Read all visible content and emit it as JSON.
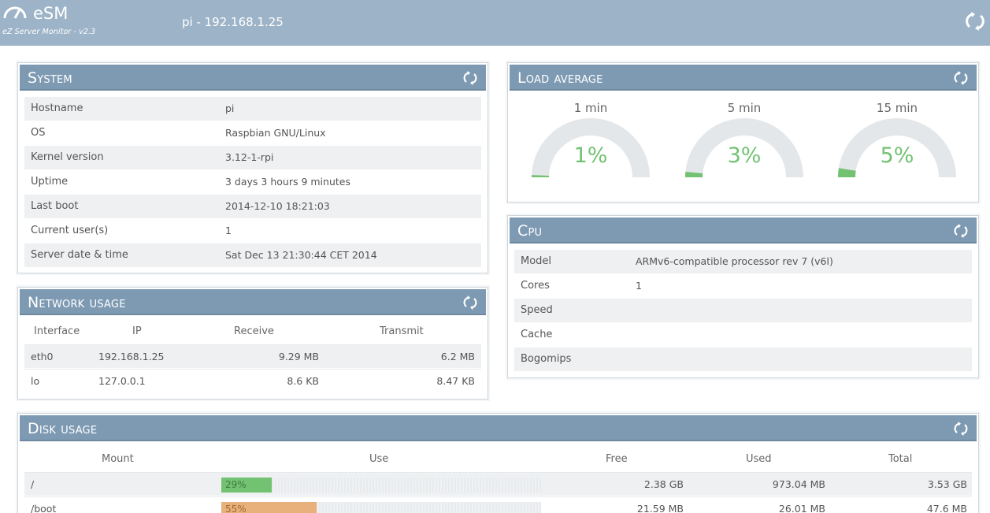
{
  "header": {
    "app_name": "eSM",
    "subtitle": "eZ Server Monitor - v2.3",
    "hostname": "pi - 192.168.1.25"
  },
  "system": {
    "title": "System",
    "rows": [
      {
        "label": "Hostname",
        "value": "pi"
      },
      {
        "label": "OS",
        "value": "Raspbian GNU/Linux"
      },
      {
        "label": "Kernel version",
        "value": "3.12-1-rpi"
      },
      {
        "label": "Uptime",
        "value": "3 days 3 hours 9 minutes"
      },
      {
        "label": "Last boot",
        "value": "2014-12-10 18:21:03"
      },
      {
        "label": "Current user(s)",
        "value": "1"
      },
      {
        "label": "Server date & time",
        "value": "Sat Dec 13 21:30:44 CET 2014"
      }
    ]
  },
  "network": {
    "title": "Network usage",
    "columns": [
      "Interface",
      "IP",
      "Receive",
      "Transmit"
    ],
    "rows": [
      {
        "interface": "eth0",
        "ip": "192.168.1.25",
        "receive": "9.29 MB",
        "transmit": "6.2 MB"
      },
      {
        "interface": "lo",
        "ip": "127.0.0.1",
        "receive": "8.6 KB",
        "transmit": "8.47 KB"
      }
    ]
  },
  "load": {
    "title": "Load average",
    "gauges": [
      {
        "label": "1 min",
        "value_text": "1%",
        "fraction": 0.01
      },
      {
        "label": "5 min",
        "value_text": "3%",
        "fraction": 0.03
      },
      {
        "label": "15 min",
        "value_text": "5%",
        "fraction": 0.05
      }
    ],
    "gauge_color": "#72c272",
    "track_color": "#e4e7ea"
  },
  "cpu": {
    "title": "Cpu",
    "rows": [
      {
        "label": "Model",
        "value": "ARMv6-compatible processor rev 7 (v6l)"
      },
      {
        "label": "Cores",
        "value": "1"
      },
      {
        "label": "Speed",
        "value": ""
      },
      {
        "label": "Cache",
        "value": ""
      },
      {
        "label": "Bogomips",
        "value": ""
      }
    ]
  },
  "disk": {
    "title": "Disk usage",
    "columns": [
      "Mount",
      "Use",
      "Free",
      "Used",
      "Total"
    ],
    "rows": [
      {
        "mount": "/",
        "use_text": "29%",
        "use_fraction": 0.29,
        "bar_color": "#72c272",
        "text_color": "#3d7a3d",
        "free": "2.38 GB",
        "used": "973.04 MB",
        "total": "3.53 GB"
      },
      {
        "mount": "/boot",
        "use_text": "55%",
        "use_fraction": 0.55,
        "bar_color": "#e8b07a",
        "text_color": "#a06a35",
        "free": "21.59 MB",
        "used": "26.01 MB",
        "total": "47.6 MB"
      }
    ]
  },
  "icons": {
    "logo": "speedometer-icon",
    "reload": "refresh-icon"
  }
}
